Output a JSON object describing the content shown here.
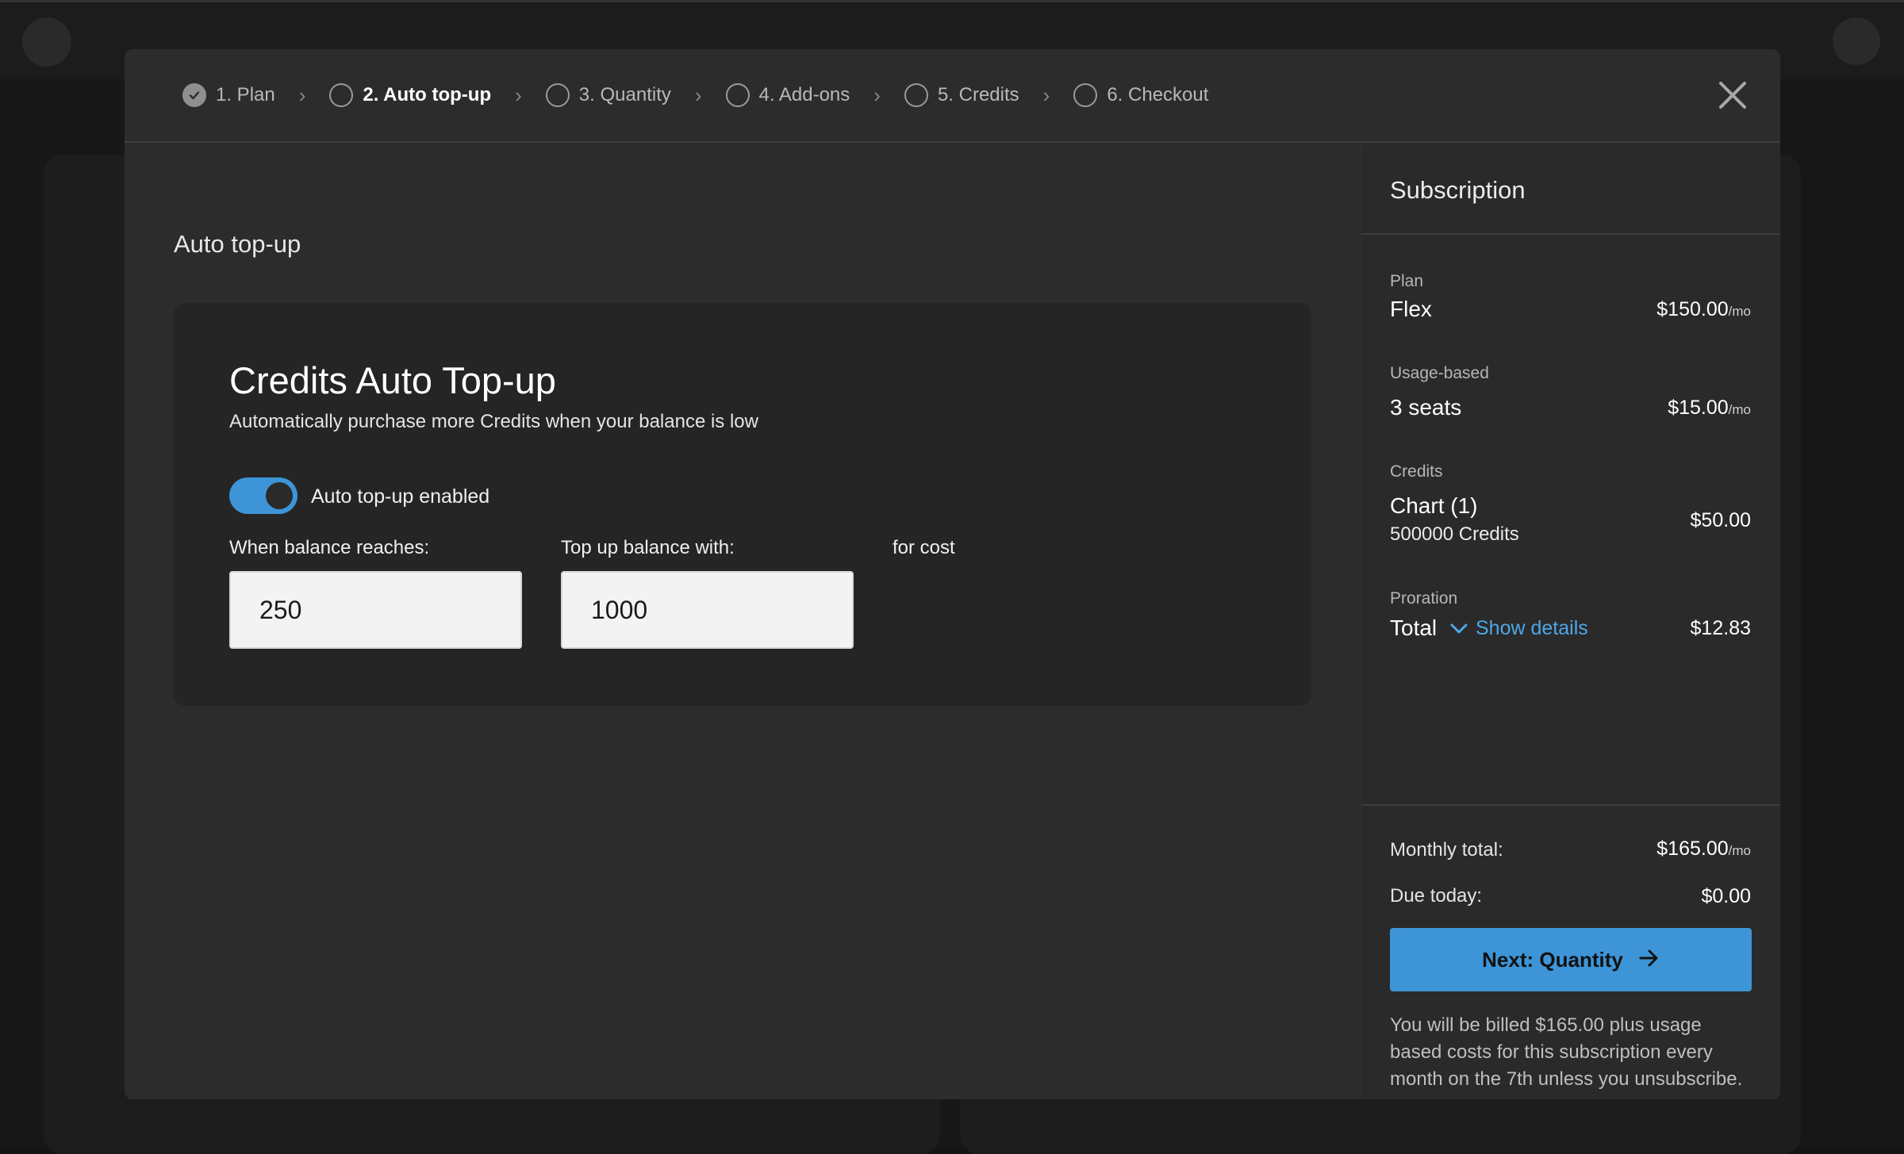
{
  "stepper": {
    "steps": [
      {
        "label": "1. Plan",
        "state": "done"
      },
      {
        "label": "2. Auto top-up",
        "state": "active"
      },
      {
        "label": "3. Quantity",
        "state": "pending"
      },
      {
        "label": "4. Add-ons",
        "state": "pending"
      },
      {
        "label": "5. Credits",
        "state": "pending"
      },
      {
        "label": "6. Checkout",
        "state": "pending"
      }
    ]
  },
  "main": {
    "section_title": "Auto top-up",
    "card": {
      "title": "Credits Auto Top-up",
      "subtitle": "Automatically purchase more Credits when your balance is low",
      "toggle_label": "Auto top-up enabled",
      "toggle_enabled": true,
      "balance_label": "When balance reaches:",
      "balance_value": "250",
      "topup_label": "Top up balance with:",
      "topup_value": "1000",
      "cost_label": "for cost"
    }
  },
  "sidebar": {
    "title": "Subscription",
    "plan": {
      "category": "Plan",
      "name": "Flex",
      "price": "$150.00",
      "unit": "/mo"
    },
    "usage": {
      "category": "Usage-based",
      "name": "3 seats",
      "price": "$15.00",
      "unit": "/mo"
    },
    "credits": {
      "category": "Credits",
      "name": "Chart (1)",
      "sub": "500000 Credits",
      "price": "$50.00"
    },
    "proration": {
      "category": "Proration",
      "name": "Total",
      "link": "Show details",
      "price": "$12.83"
    },
    "monthly_label": "Monthly total:",
    "monthly_value": "$165.00",
    "monthly_unit": "/mo",
    "due_label": "Due today:",
    "due_value": "$0.00",
    "next_button": "Next: Quantity",
    "billing_note": "You will be billed $165.00 plus usage based costs for this subscription every month on the 7th unless you unsubscribe."
  },
  "colors": {
    "accent": "#3d95d8",
    "link": "#4ea7e8",
    "modal_bg": "#2c2c2c",
    "card_bg": "#252525"
  },
  "icons": [
    "check-icon",
    "chevron-right-icon",
    "close-icon",
    "chevron-down-icon",
    "arrow-right-icon"
  ]
}
